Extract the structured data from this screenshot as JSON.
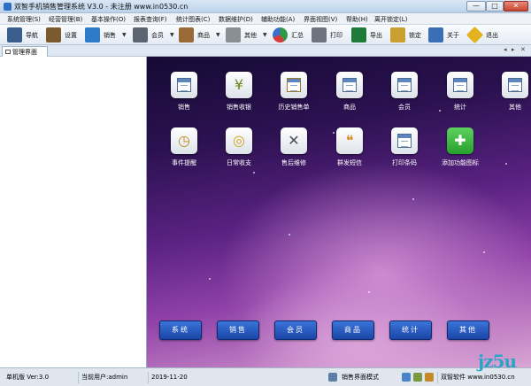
{
  "window": {
    "title": "双智手机销售管理系统 V3.0 - 未注册 www.in0530.cn",
    "min": "—",
    "max": "□",
    "close": "✕"
  },
  "menu": [
    "系统管理(S)",
    "经营管理(B)",
    "基本操作(O)",
    "报表查询(F)",
    "统计图表(C)",
    "数据维护(D)",
    "辅助功能(A)",
    "界面视图(V)",
    "帮助(H)",
    "离开锁定(L)"
  ],
  "toolbar": [
    {
      "label": "导航",
      "icon": "navigation-icon",
      "color": "#3a5f8f"
    },
    {
      "label": "设置",
      "icon": "settings-book-icon",
      "color": "#7a5a2e"
    },
    {
      "label": "销售",
      "icon": "shop-icon",
      "color": "#2c7cc9",
      "dropdown": "▼"
    },
    {
      "label": "会员",
      "icon": "member-card-icon",
      "color": "#5b6470",
      "dropdown": "▼"
    },
    {
      "label": "商品",
      "icon": "goods-box-icon",
      "color": "#9a6a36",
      "dropdown": "▼"
    },
    {
      "label": "其他",
      "icon": "calculator-icon",
      "color": "#8a8f96",
      "dropdown": "▼"
    },
    {
      "label": "汇总",
      "icon": "pie-chart-icon",
      "color": "#2e9a47"
    },
    {
      "label": "打印",
      "icon": "printer-icon",
      "color": "#6d7480"
    },
    {
      "label": "导出",
      "icon": "excel-icon",
      "color": "#1f7a3a"
    },
    {
      "label": "锁定",
      "icon": "lock-icon",
      "color": "#c9a030"
    },
    {
      "label": "关于",
      "icon": "about-monitor-icon",
      "color": "#3b6fb5"
    },
    {
      "label": "退出",
      "icon": "exit-sign-icon",
      "color": "#e3b21e"
    }
  ],
  "tabs": {
    "active": "管理界面",
    "controls": [
      "◂",
      "▸",
      "✕"
    ]
  },
  "functions_row1": [
    {
      "label": "销售",
      "icon": "sales-sheet-icon"
    },
    {
      "label": "销售收银",
      "icon": "cashier-yen-icon",
      "glyph": "¥"
    },
    {
      "label": "历史销售单",
      "icon": "history-orders-icon"
    },
    {
      "label": "商品",
      "icon": "goods-sheet-icon"
    },
    {
      "label": "会员",
      "icon": "member-sheet-icon"
    },
    {
      "label": "统计",
      "icon": "statistics-sheet-icon"
    },
    {
      "label": "其他",
      "icon": "other-sheet-icon"
    }
  ],
  "functions_row2": [
    {
      "label": "事件提醒",
      "icon": "clock-reminder-icon",
      "glyph": "◷"
    },
    {
      "label": "日常收支",
      "icon": "coins-icon",
      "glyph": "◎"
    },
    {
      "label": "售后维修",
      "icon": "tools-icon",
      "glyph": "✕"
    },
    {
      "label": "群发短信",
      "icon": "chat-bubbles-icon",
      "glyph": "❝"
    },
    {
      "label": "打印条码",
      "icon": "barcode-sheet-icon"
    },
    {
      "label": "添加功能图标",
      "icon": "add-plus-icon",
      "glyph": "✚"
    }
  ],
  "nav_buttons": [
    "系统",
    "销售",
    "会员",
    "商品",
    "统计",
    "其他"
  ],
  "status": {
    "edition": "单机版 Ver:3.0",
    "user": "当前用户:admin",
    "date": "2019-11-20",
    "mode": "销售界面模式",
    "vendor": "双智软件 www.in0530.cn"
  },
  "watermark": "jz5u",
  "colors": {
    "accent": "#1b45a6",
    "background_top": "#160a35",
    "background_glow": "#d9a6d4"
  }
}
